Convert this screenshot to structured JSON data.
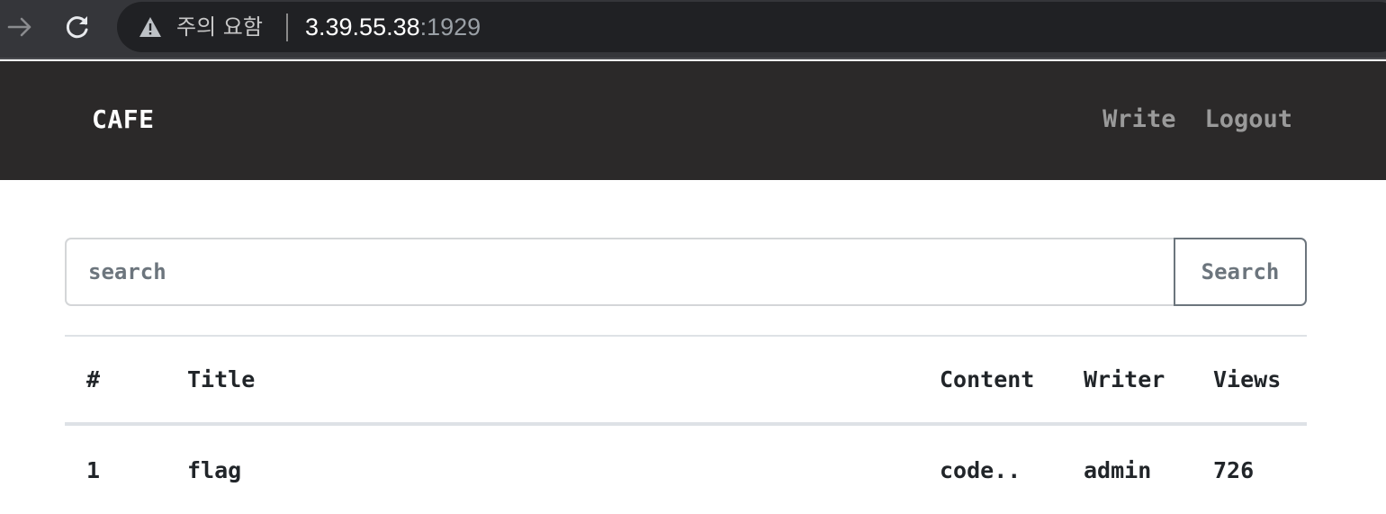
{
  "browser": {
    "security_label": "주의 요함",
    "url_host": "3.39.55.38",
    "url_port": ":1929",
    "icons": [
      "forward-arrow-icon",
      "reload-icon",
      "warning-icon"
    ]
  },
  "navbar": {
    "brand": "CAFE",
    "links": [
      {
        "label": "Write"
      },
      {
        "label": "Logout"
      }
    ]
  },
  "search": {
    "placeholder": "search",
    "button_label": "Search"
  },
  "table": {
    "headers": [
      "#",
      "Title",
      "Content",
      "Writer",
      "Views"
    ],
    "rows": [
      {
        "num": "1",
        "title": "flag",
        "content": "code..",
        "writer": "admin",
        "views": "726"
      }
    ]
  }
}
